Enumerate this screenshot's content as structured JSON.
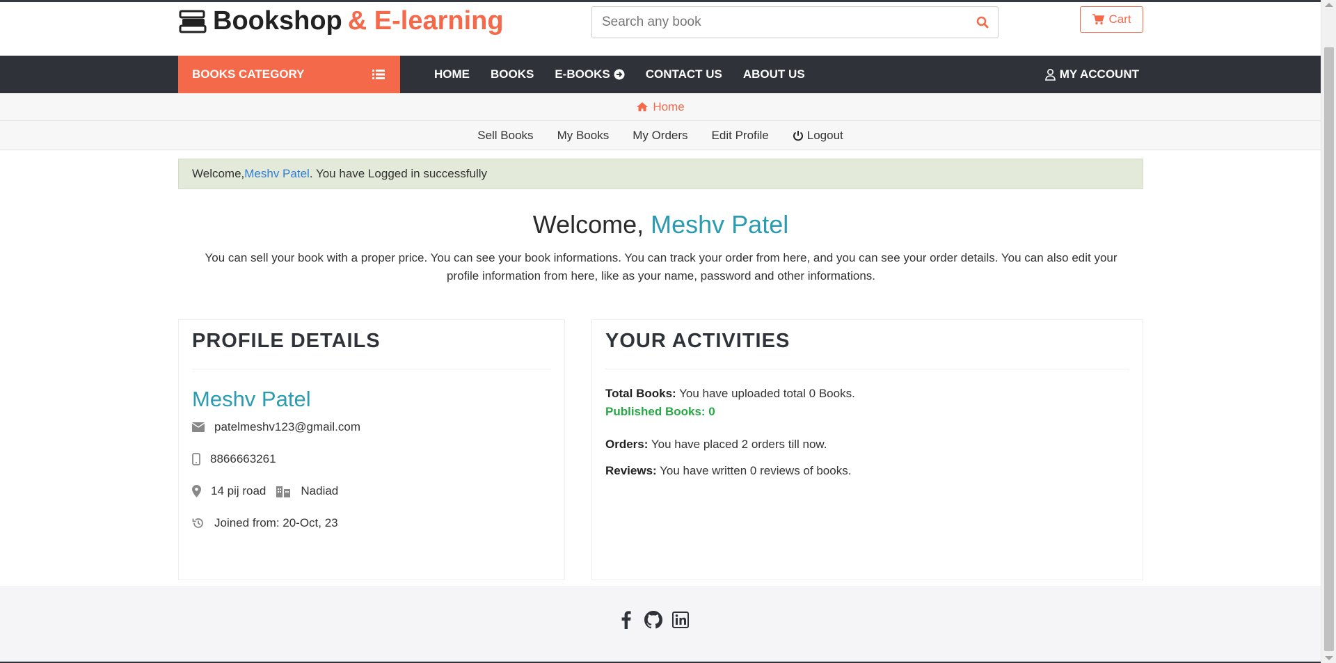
{
  "brand": {
    "name_dark": "Bookshop",
    "name_accent": "& E-learning"
  },
  "search": {
    "placeholder": "Search any book"
  },
  "cart": {
    "label": "Cart"
  },
  "nav": {
    "category_label": "BOOKS CATEGORY",
    "links": [
      "HOME",
      "BOOKS",
      "E-BOOKS",
      "CONTACT US",
      "ABOUT US"
    ],
    "account_label": "MY ACCOUNT"
  },
  "breadcrumb": {
    "label": "Home"
  },
  "subnav": {
    "items": [
      "Sell Books",
      "My Books",
      "My Orders",
      "Edit Profile",
      "Logout"
    ]
  },
  "alert": {
    "prefix": "Welcome, ",
    "name": "Meshv Patel",
    "suffix": ". You have Logged in successfully"
  },
  "welcome": {
    "prefix": "Welcome, ",
    "name": "Meshv Patel",
    "intro": "You can sell your book with a proper price. You can see your book informations. You can track your order from here, and you can see your order details. You can also edit your profile information from here, like as your name, password and other informations."
  },
  "profile": {
    "title": "PROFILE DETAILS",
    "name": "Meshv Patel",
    "email": "patelmeshv123@gmail.com",
    "phone": "8866663261",
    "address": "14 pij road",
    "city": "Nadiad",
    "joined": "Joined from: 20-Oct, 23"
  },
  "activities": {
    "title": "YOUR ACTIVITIES",
    "total_books_label": "Total Books:",
    "total_books_text": " You have uploaded total 0 Books.",
    "published_books": "Published Books: 0",
    "orders_label": "Orders:",
    "orders_text": " You have placed 2 orders till now.",
    "reviews_label": "Reviews:",
    "reviews_text": " You have written 0 reviews of books."
  },
  "colors": {
    "accent": "#f4694a",
    "navbar": "#2f3238",
    "name_teal": "#2a9bb0",
    "success": "#28a745"
  },
  "footer": {
    "icons": [
      "facebook-icon",
      "github-icon",
      "linkedin-icon"
    ]
  }
}
